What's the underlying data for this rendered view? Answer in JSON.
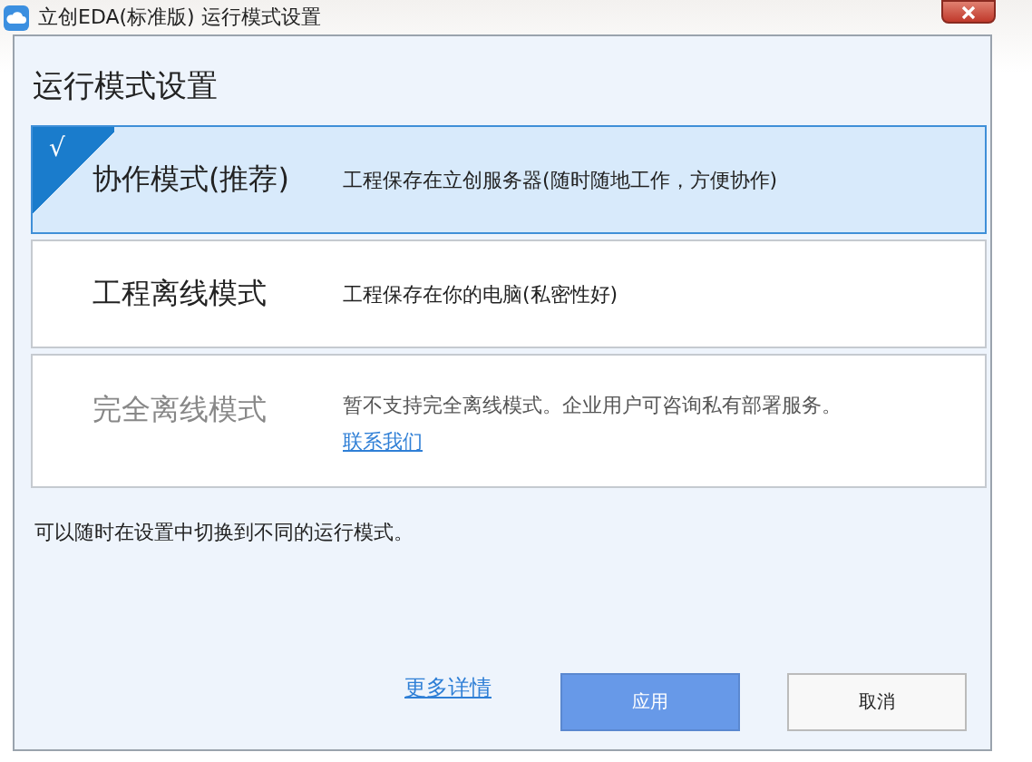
{
  "window": {
    "title": "立创EDA(标准版) 运行模式设置"
  },
  "heading": "运行模式设置",
  "modes": [
    {
      "name": "协作模式(推荐)",
      "description": "工程保存在立创服务器(随时随地工作，方便协作)",
      "selected": true,
      "disabled": false,
      "check": "√"
    },
    {
      "name": "工程离线模式",
      "description": "工程保存在你的电脑(私密性好)",
      "selected": false,
      "disabled": false
    },
    {
      "name": "完全离线模式",
      "description": "暂不支持完全离线模式。企业用户可咨询私有部署服务。",
      "link": "联系我们",
      "selected": false,
      "disabled": true
    }
  ],
  "note": "可以随时在设置中切换到不同的运行模式。",
  "footer": {
    "link": "更多详情",
    "buttons": [
      {
        "label": "应用",
        "kind": "primary"
      },
      {
        "label": "取消",
        "kind": "secondary"
      }
    ]
  }
}
